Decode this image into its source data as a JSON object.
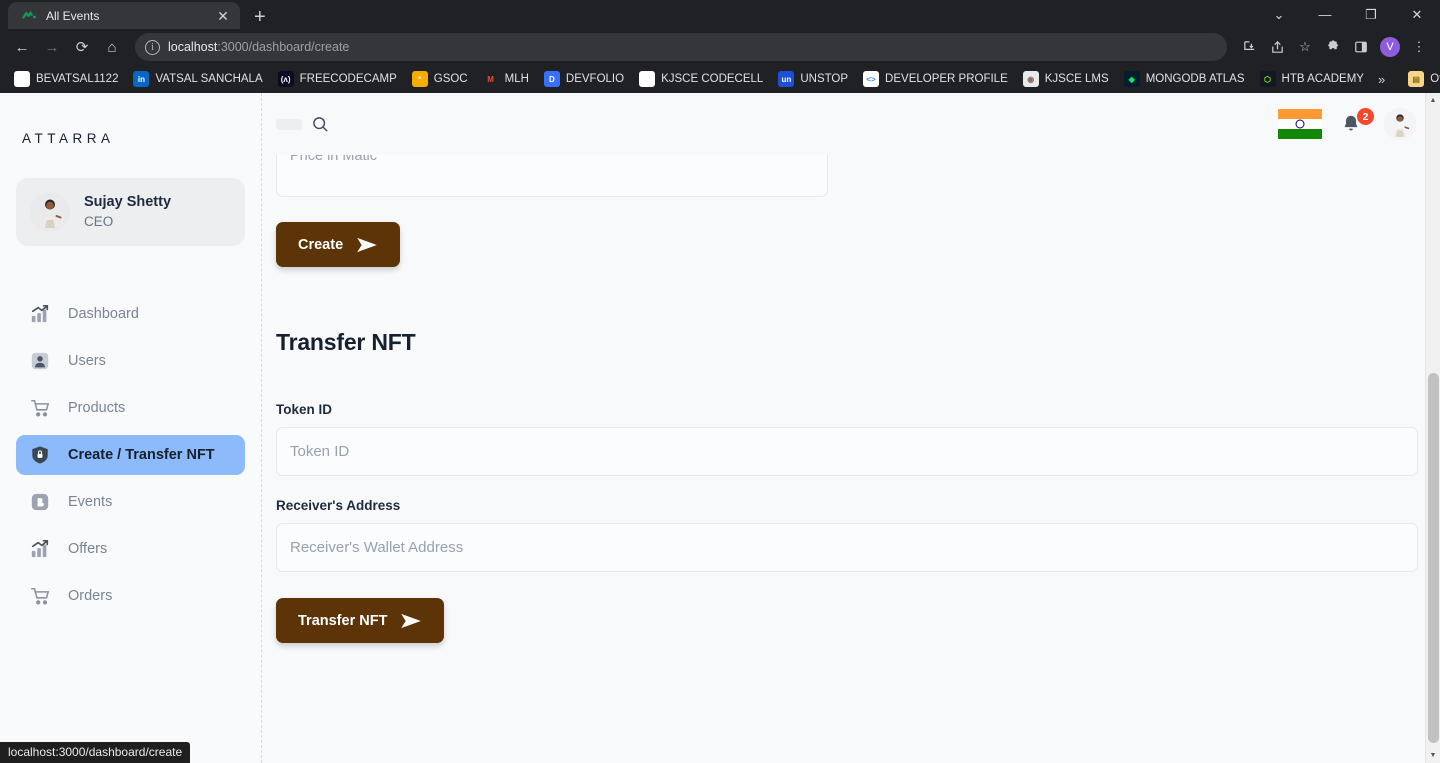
{
  "browser": {
    "tab": {
      "title": "All Events",
      "favicon": "chart-zigzag-icon",
      "close": "✕"
    },
    "newtab_label": "+",
    "window_controls": [
      {
        "name": "chevron-down-icon",
        "glyph": "⌄"
      },
      {
        "name": "minimize-icon",
        "glyph": "—"
      },
      {
        "name": "maximize-icon",
        "glyph": "❐"
      },
      {
        "name": "close-window-icon",
        "glyph": "✕"
      }
    ],
    "nav": {
      "back": "←",
      "forward": "→",
      "reload": "⟳",
      "home": "⌂"
    },
    "omnibox": {
      "info_icon": "ⓘ",
      "url_host": "localhost",
      "url_path": ":3000/dashboard/create"
    },
    "toolbar_icons": [
      {
        "name": "downloads-icon",
        "glyph": "⤓"
      },
      {
        "name": "share-icon",
        "glyph": "↗"
      },
      {
        "name": "bookmark-star-icon",
        "glyph": "☆"
      },
      {
        "name": "extensions-icon",
        "glyph": "🧩"
      },
      {
        "name": "side-panel-icon",
        "glyph": "▣"
      }
    ],
    "profile_initial": "V",
    "menu_icon": "⋮",
    "bookmarks": [
      {
        "label": "BEVATSAL1122",
        "icon": "github-icon",
        "bg": "#ffffff",
        "fg": "#1b1f23",
        "ch": ""
      },
      {
        "label": "VATSAL SANCHALA",
        "icon": "linkedin-icon",
        "bg": "#0a66c2",
        "fg": "#ffffff",
        "ch": "in"
      },
      {
        "label": "FREECODECAMP",
        "icon": "freecodecamp-icon",
        "bg": "#0a0a23",
        "fg": "#ffffff",
        "ch": "(ʌ)"
      },
      {
        "label": "GSOC",
        "icon": "gsoc-icon",
        "bg": "#f9ab00",
        "fg": "#ffffff",
        "ch": "*"
      },
      {
        "label": "MLH",
        "icon": "mlh-icon",
        "bg": "#202124",
        "fg": "#e74c3c",
        "ch": "M"
      },
      {
        "label": "DEVFOLIO",
        "icon": "devfolio-icon",
        "bg": "#3770ff",
        "fg": "#ffffff",
        "ch": "D"
      },
      {
        "label": "KJSCE CODECELL",
        "icon": "github-icon",
        "bg": "#ffffff",
        "fg": "#1b1f23",
        "ch": ""
      },
      {
        "label": "UNSTOP",
        "icon": "unstop-icon",
        "bg": "#1d4fd8",
        "fg": "#ffffff",
        "ch": "un"
      },
      {
        "label": "DEVELOPER PROFILE",
        "icon": "developer-profile-icon",
        "bg": "#ffffff",
        "fg": "#4285f4",
        "ch": "<>"
      },
      {
        "label": "KJSCE LMS",
        "icon": "kjsce-lms-icon",
        "bg": "#e8eaed",
        "fg": "#8d6e63",
        "ch": "◉"
      },
      {
        "label": "MONGODB ATLAS",
        "icon": "mongodb-icon",
        "bg": "#001e2b",
        "fg": "#00ed64",
        "ch": "◆"
      },
      {
        "label": "HTB ACADEMY",
        "icon": "hackthebox-icon",
        "bg": "#111927",
        "fg": "#9fef00",
        "ch": "⬡"
      }
    ],
    "overflow_label": "»",
    "other_bookmarks": {
      "label": "Other bookmarks",
      "icon": "folder-icon"
    }
  },
  "app": {
    "logo": "ATTARRA",
    "profile": {
      "name": "Sujay Shetty",
      "role": "CEO",
      "avatar": "user-avatar"
    },
    "sidebar_items": [
      {
        "label": "Dashboard",
        "icon": "chart-bar-icon",
        "active": false
      },
      {
        "label": "Users",
        "icon": "user-icon",
        "active": false
      },
      {
        "label": "Products",
        "icon": "cart-icon",
        "active": false
      },
      {
        "label": "Create / Transfer NFT",
        "icon": "shield-lock-icon",
        "active": true
      },
      {
        "label": "Events",
        "icon": "blogger-b-icon",
        "active": false
      },
      {
        "label": "Offers",
        "icon": "chart-bar-icon",
        "active": false
      },
      {
        "label": "Orders",
        "icon": "cart-icon",
        "active": false
      }
    ],
    "topbar": {
      "search_icon": "search-icon",
      "flag_icon": "india-flag-icon",
      "notification_icon": "bell-icon",
      "notification_count": "2",
      "avatar": "user-avatar"
    },
    "create_section": {
      "price_placeholder": "Price in Matic",
      "create_button": "Create",
      "send_icon": "send-icon"
    },
    "transfer_section": {
      "heading": "Transfer NFT",
      "token_label": "Token ID",
      "token_placeholder": "Token ID",
      "token_value": "",
      "address_label": "Receiver's Address",
      "address_placeholder": "Receiver's Wallet Address",
      "address_value": "",
      "transfer_button": "Transfer NFT",
      "send_icon": "send-icon"
    },
    "colors": {
      "brand_brown": "#5c3407",
      "active_nav": "#8cbafa",
      "badge_red": "#f4492d",
      "page_bg": "#f8f9fb"
    }
  },
  "status_bar": {
    "url": "localhost:3000/dashboard/create"
  }
}
